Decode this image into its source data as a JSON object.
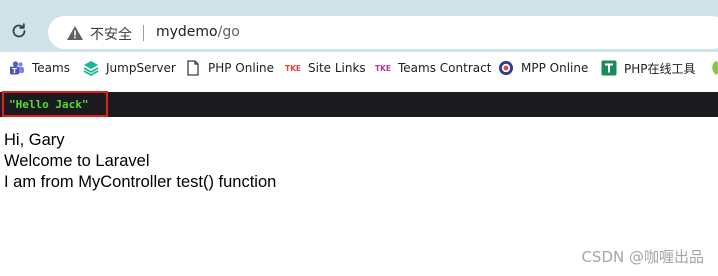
{
  "browser": {
    "security_label": "不安全",
    "url_host": "mydemo",
    "url_path": "/go",
    "icons": {
      "reload": "reload-icon",
      "warning": "warning-triangle-icon"
    }
  },
  "bookmarks": [
    {
      "label": "Teams",
      "icon": "teams-icon"
    },
    {
      "label": "JumpServer",
      "icon": "jumpserver-icon"
    },
    {
      "label": "PHP Online",
      "icon": "page-icon"
    },
    {
      "label": "Site Links",
      "icon": "tke-icon"
    },
    {
      "label": "Teams Contract",
      "icon": "tke-icon"
    },
    {
      "label": "MPP Online",
      "icon": "mpp-icon"
    },
    {
      "label": "PHP在线工具",
      "icon": "t-icon"
    }
  ],
  "dump": {
    "text": "\"Hello Jack\""
  },
  "content": {
    "line1": "Hi, Gary",
    "line2": "Welcome to Laravel",
    "line3": "I am from MyController test() function"
  },
  "watermark": "CSDN @咖喱出品",
  "colors": {
    "topbar": "#cfe2e7",
    "dark_strip": "#1b1b1f",
    "dump_text": "#56db3a",
    "highlight_border": "#e2201c"
  }
}
